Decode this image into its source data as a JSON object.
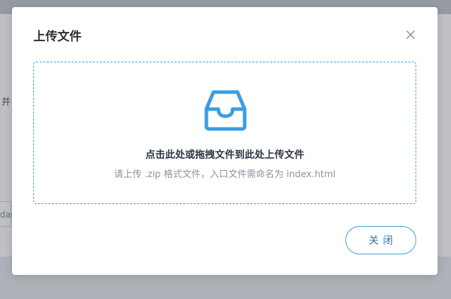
{
  "background": {
    "partial_text": "并",
    "partial_input_value": "das"
  },
  "modal": {
    "title": "上传文件",
    "close_icon": "close-icon",
    "dropzone": {
      "icon": "inbox-icon",
      "main_text": "点击此处或拖拽文件到此处上传文件",
      "hint_text": "请上传 .zip 格式文件，入口文件需命名为 index.html"
    },
    "close_button_label": "关闭"
  },
  "colors": {
    "accent": "#3d9ed8",
    "icon_blue": "#3a9de3",
    "title_text": "#2b2f36",
    "hint_text": "#8a949f"
  }
}
